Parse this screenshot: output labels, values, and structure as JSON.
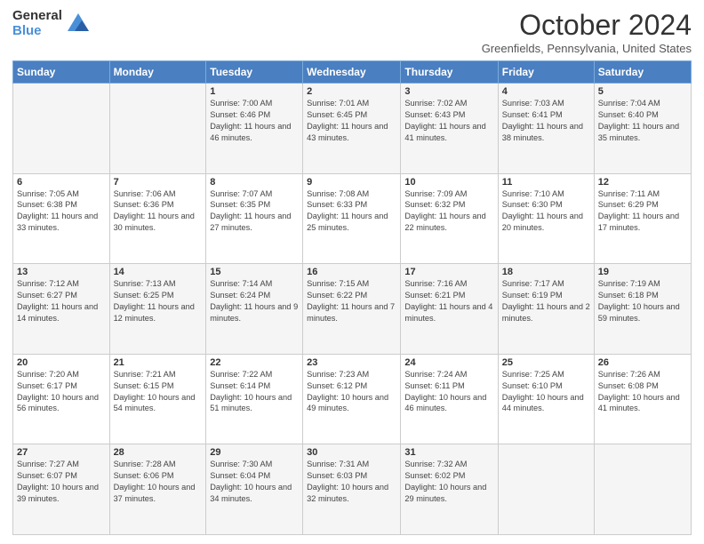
{
  "logo": {
    "general": "General",
    "blue": "Blue"
  },
  "header": {
    "month": "October 2024",
    "location": "Greenfields, Pennsylvania, United States"
  },
  "weekdays": [
    "Sunday",
    "Monday",
    "Tuesday",
    "Wednesday",
    "Thursday",
    "Friday",
    "Saturday"
  ],
  "weeks": [
    [
      {
        "day": "",
        "info": ""
      },
      {
        "day": "",
        "info": ""
      },
      {
        "day": "1",
        "info": "Sunrise: 7:00 AM\nSunset: 6:46 PM\nDaylight: 11 hours and 46 minutes."
      },
      {
        "day": "2",
        "info": "Sunrise: 7:01 AM\nSunset: 6:45 PM\nDaylight: 11 hours and 43 minutes."
      },
      {
        "day": "3",
        "info": "Sunrise: 7:02 AM\nSunset: 6:43 PM\nDaylight: 11 hours and 41 minutes."
      },
      {
        "day": "4",
        "info": "Sunrise: 7:03 AM\nSunset: 6:41 PM\nDaylight: 11 hours and 38 minutes."
      },
      {
        "day": "5",
        "info": "Sunrise: 7:04 AM\nSunset: 6:40 PM\nDaylight: 11 hours and 35 minutes."
      }
    ],
    [
      {
        "day": "6",
        "info": "Sunrise: 7:05 AM\nSunset: 6:38 PM\nDaylight: 11 hours and 33 minutes."
      },
      {
        "day": "7",
        "info": "Sunrise: 7:06 AM\nSunset: 6:36 PM\nDaylight: 11 hours and 30 minutes."
      },
      {
        "day": "8",
        "info": "Sunrise: 7:07 AM\nSunset: 6:35 PM\nDaylight: 11 hours and 27 minutes."
      },
      {
        "day": "9",
        "info": "Sunrise: 7:08 AM\nSunset: 6:33 PM\nDaylight: 11 hours and 25 minutes."
      },
      {
        "day": "10",
        "info": "Sunrise: 7:09 AM\nSunset: 6:32 PM\nDaylight: 11 hours and 22 minutes."
      },
      {
        "day": "11",
        "info": "Sunrise: 7:10 AM\nSunset: 6:30 PM\nDaylight: 11 hours and 20 minutes."
      },
      {
        "day": "12",
        "info": "Sunrise: 7:11 AM\nSunset: 6:29 PM\nDaylight: 11 hours and 17 minutes."
      }
    ],
    [
      {
        "day": "13",
        "info": "Sunrise: 7:12 AM\nSunset: 6:27 PM\nDaylight: 11 hours and 14 minutes."
      },
      {
        "day": "14",
        "info": "Sunrise: 7:13 AM\nSunset: 6:25 PM\nDaylight: 11 hours and 12 minutes."
      },
      {
        "day": "15",
        "info": "Sunrise: 7:14 AM\nSunset: 6:24 PM\nDaylight: 11 hours and 9 minutes."
      },
      {
        "day": "16",
        "info": "Sunrise: 7:15 AM\nSunset: 6:22 PM\nDaylight: 11 hours and 7 minutes."
      },
      {
        "day": "17",
        "info": "Sunrise: 7:16 AM\nSunset: 6:21 PM\nDaylight: 11 hours and 4 minutes."
      },
      {
        "day": "18",
        "info": "Sunrise: 7:17 AM\nSunset: 6:19 PM\nDaylight: 11 hours and 2 minutes."
      },
      {
        "day": "19",
        "info": "Sunrise: 7:19 AM\nSunset: 6:18 PM\nDaylight: 10 hours and 59 minutes."
      }
    ],
    [
      {
        "day": "20",
        "info": "Sunrise: 7:20 AM\nSunset: 6:17 PM\nDaylight: 10 hours and 56 minutes."
      },
      {
        "day": "21",
        "info": "Sunrise: 7:21 AM\nSunset: 6:15 PM\nDaylight: 10 hours and 54 minutes."
      },
      {
        "day": "22",
        "info": "Sunrise: 7:22 AM\nSunset: 6:14 PM\nDaylight: 10 hours and 51 minutes."
      },
      {
        "day": "23",
        "info": "Sunrise: 7:23 AM\nSunset: 6:12 PM\nDaylight: 10 hours and 49 minutes."
      },
      {
        "day": "24",
        "info": "Sunrise: 7:24 AM\nSunset: 6:11 PM\nDaylight: 10 hours and 46 minutes."
      },
      {
        "day": "25",
        "info": "Sunrise: 7:25 AM\nSunset: 6:10 PM\nDaylight: 10 hours and 44 minutes."
      },
      {
        "day": "26",
        "info": "Sunrise: 7:26 AM\nSunset: 6:08 PM\nDaylight: 10 hours and 41 minutes."
      }
    ],
    [
      {
        "day": "27",
        "info": "Sunrise: 7:27 AM\nSunset: 6:07 PM\nDaylight: 10 hours and 39 minutes."
      },
      {
        "day": "28",
        "info": "Sunrise: 7:28 AM\nSunset: 6:06 PM\nDaylight: 10 hours and 37 minutes."
      },
      {
        "day": "29",
        "info": "Sunrise: 7:30 AM\nSunset: 6:04 PM\nDaylight: 10 hours and 34 minutes."
      },
      {
        "day": "30",
        "info": "Sunrise: 7:31 AM\nSunset: 6:03 PM\nDaylight: 10 hours and 32 minutes."
      },
      {
        "day": "31",
        "info": "Sunrise: 7:32 AM\nSunset: 6:02 PM\nDaylight: 10 hours and 29 minutes."
      },
      {
        "day": "",
        "info": ""
      },
      {
        "day": "",
        "info": ""
      }
    ]
  ]
}
